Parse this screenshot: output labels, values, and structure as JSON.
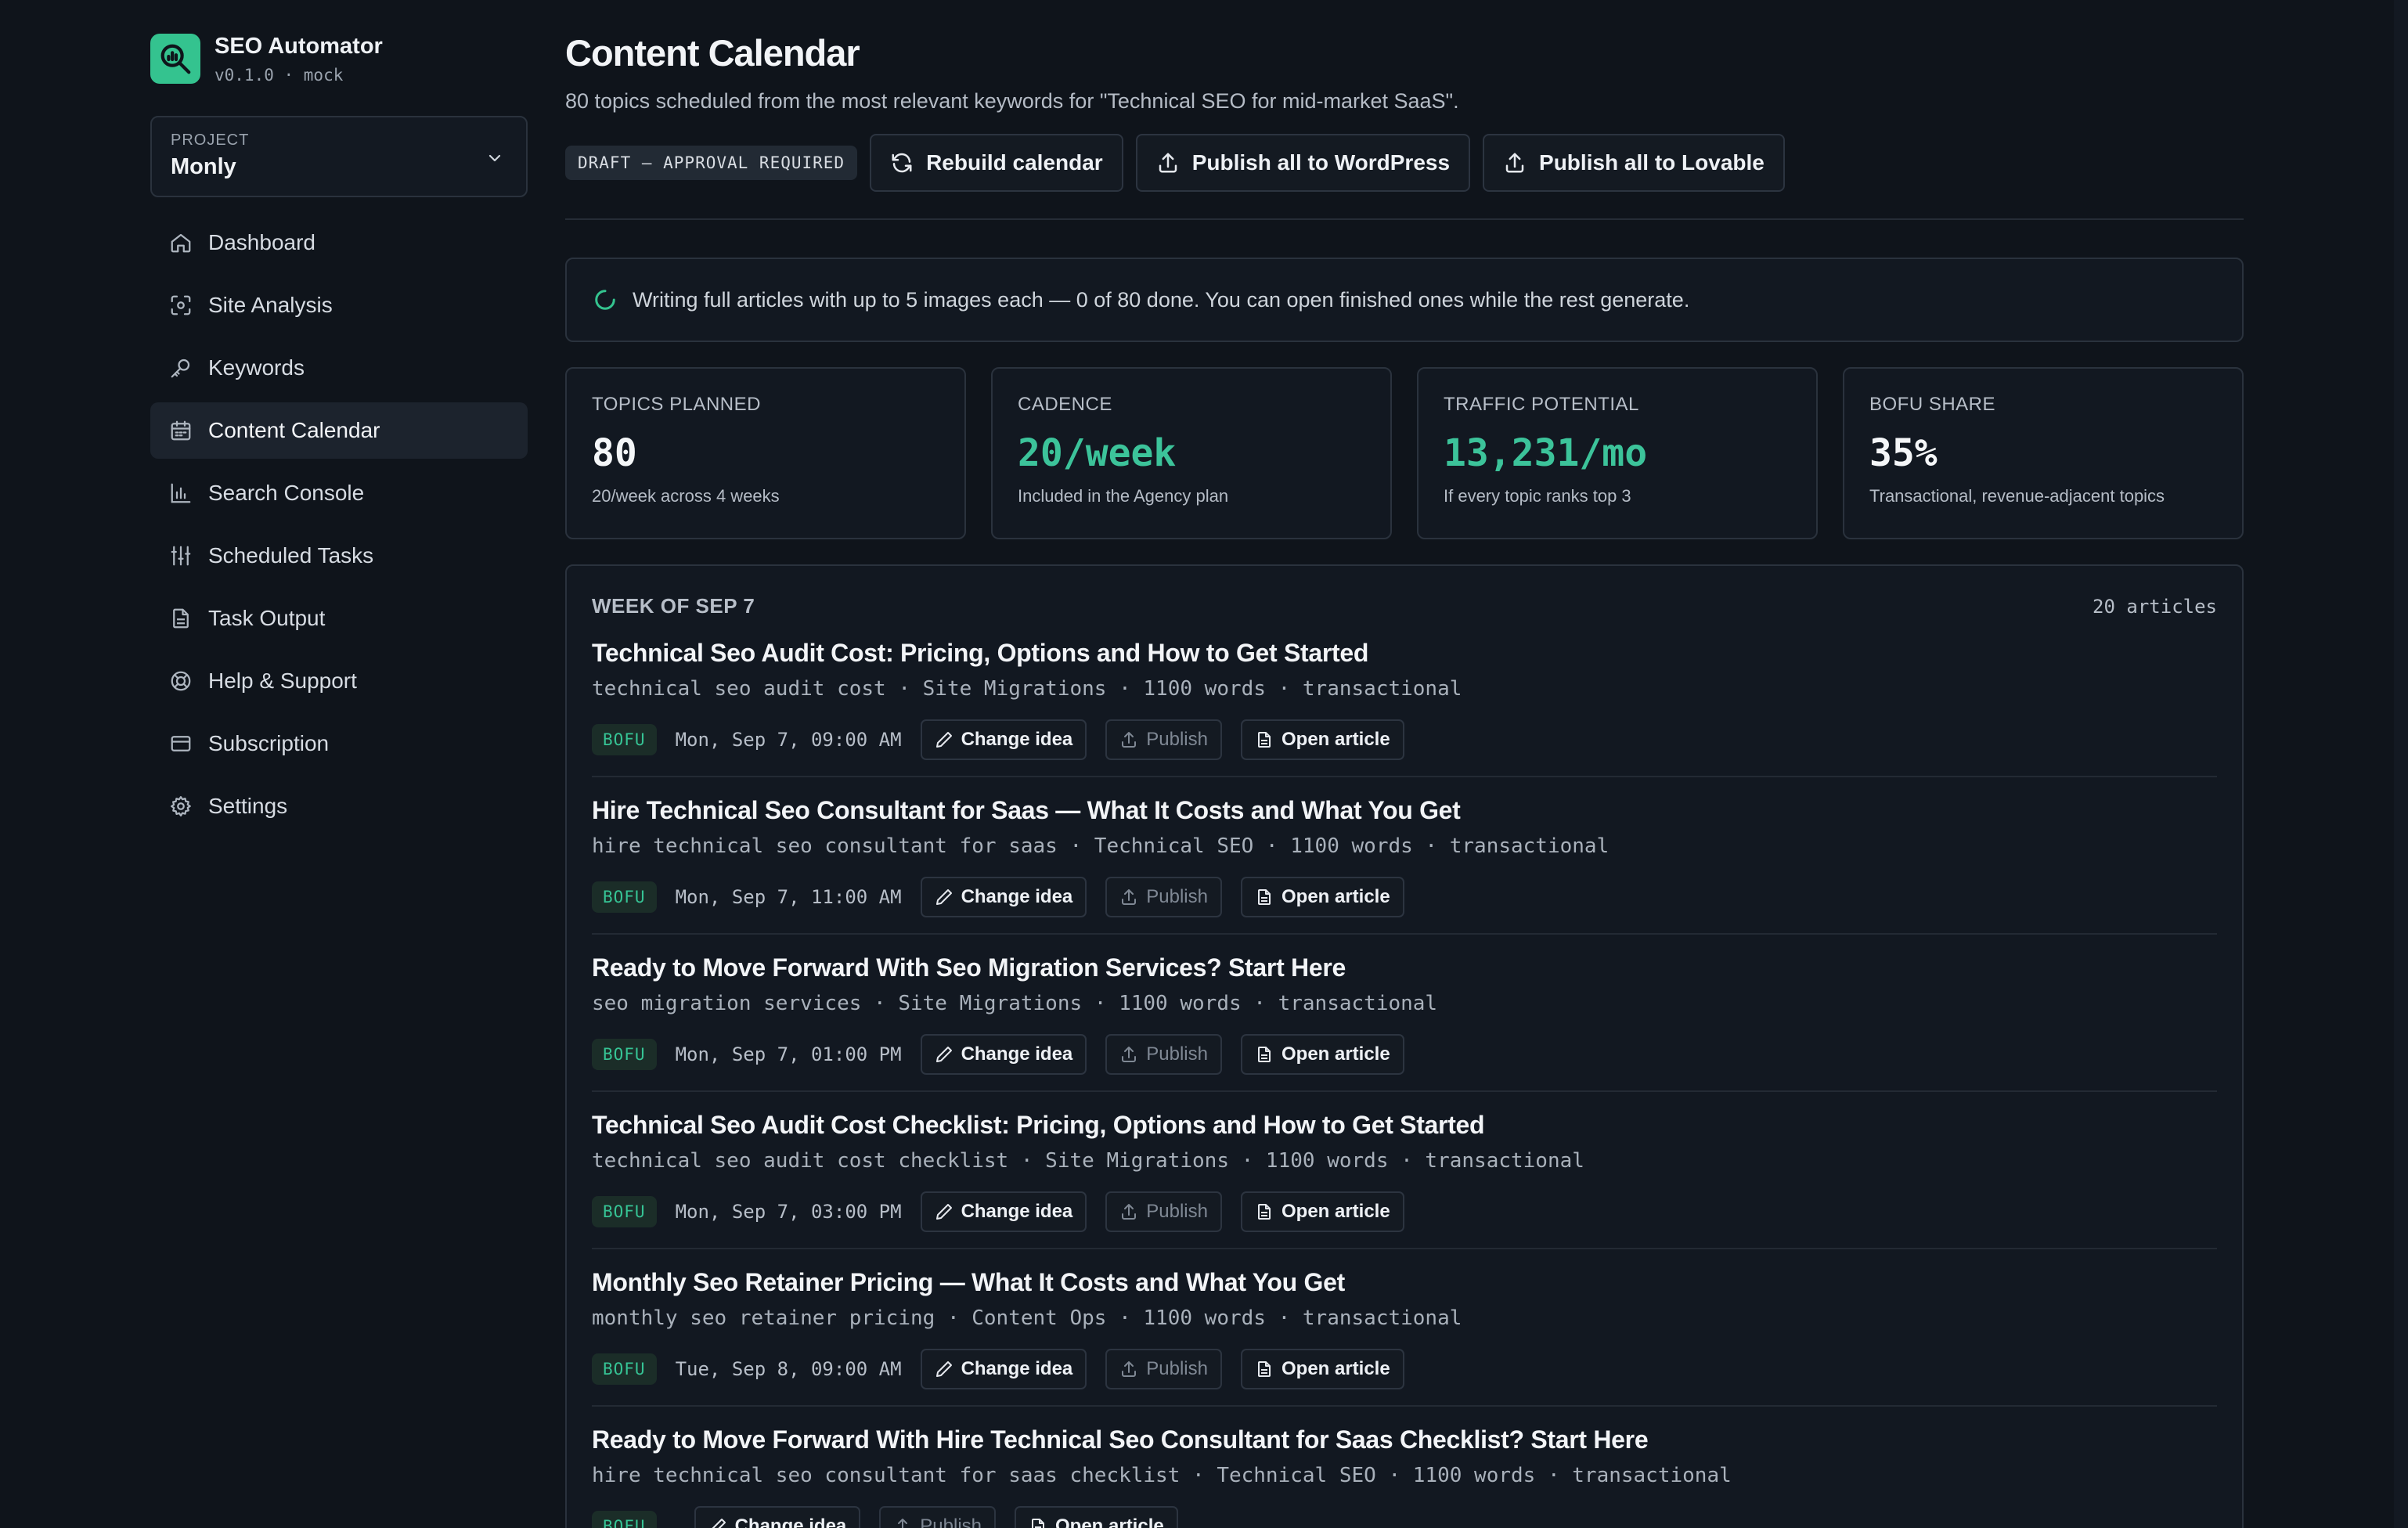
{
  "brand": {
    "name": "SEO Automator",
    "version": "v0.1.0 · mock"
  },
  "project": {
    "label": "PROJECT",
    "value": "Monly"
  },
  "nav": [
    {
      "label": "Dashboard",
      "icon": "home-icon",
      "active": false
    },
    {
      "label": "Site Analysis",
      "icon": "scan-icon",
      "active": false
    },
    {
      "label": "Keywords",
      "icon": "key-icon",
      "active": false
    },
    {
      "label": "Content Calendar",
      "icon": "calendar-icon",
      "active": true
    },
    {
      "label": "Search Console",
      "icon": "bar-chart-icon",
      "active": false
    },
    {
      "label": "Scheduled Tasks",
      "icon": "sliders-icon",
      "active": false
    },
    {
      "label": "Task Output",
      "icon": "file-icon",
      "active": false
    },
    {
      "label": "Help & Support",
      "icon": "lifebuoy-icon",
      "active": false
    },
    {
      "label": "Subscription",
      "icon": "credit-card-icon",
      "active": false
    },
    {
      "label": "Settings",
      "icon": "gear-icon",
      "active": false
    }
  ],
  "page": {
    "title": "Content Calendar",
    "subtitle": "80 topics scheduled from the most relevant keywords for \"Technical SEO for mid-market SaaS\"."
  },
  "toolbar": {
    "draft_badge": "DRAFT — APPROVAL REQUIRED",
    "rebuild": "Rebuild calendar",
    "publish_wp": "Publish all to WordPress",
    "publish_lovable": "Publish all to Lovable"
  },
  "progress": {
    "text": "Writing full articles with up to 5 images each — 0 of 80 done. You can open finished ones while the rest generate."
  },
  "stats": [
    {
      "label": "TOPICS PLANNED",
      "value": "80",
      "sub": "20/week across 4 weeks",
      "accent": false
    },
    {
      "label": "CADENCE",
      "value": "20/week",
      "sub": "Included in the Agency plan",
      "accent": true
    },
    {
      "label": "TRAFFIC POTENTIAL",
      "value": "13,231/mo",
      "sub": "If every topic ranks top 3",
      "accent": true
    },
    {
      "label": "BOFU SHARE",
      "value": "35%",
      "sub": "Transactional, revenue-adjacent topics",
      "accent": false
    }
  ],
  "week": {
    "title": "WEEK OF SEP 7",
    "count": "20 articles",
    "buttons": {
      "change": "Change idea",
      "publish": "Publish",
      "open": "Open article"
    },
    "articles": [
      {
        "title": "Technical Seo Audit Cost: Pricing, Options and How to Get Started",
        "meta": "technical seo audit cost · Site Migrations · 1100 words · transactional",
        "stage": "BOFU",
        "date": "Mon, Sep 7, 09:00 AM"
      },
      {
        "title": "Hire Technical Seo Consultant for Saas — What It Costs and What You Get",
        "meta": "hire technical seo consultant for saas · Technical SEO · 1100 words · transactional",
        "stage": "BOFU",
        "date": "Mon, Sep 7, 11:00 AM"
      },
      {
        "title": "Ready to Move Forward With Seo Migration Services? Start Here",
        "meta": "seo migration services · Site Migrations · 1100 words · transactional",
        "stage": "BOFU",
        "date": "Mon, Sep 7, 01:00 PM"
      },
      {
        "title": "Technical Seo Audit Cost Checklist: Pricing, Options and How to Get Started",
        "meta": "technical seo audit cost checklist · Site Migrations · 1100 words · transactional",
        "stage": "BOFU",
        "date": "Mon, Sep 7, 03:00 PM"
      },
      {
        "title": "Monthly Seo Retainer Pricing — What It Costs and What You Get",
        "meta": "monthly seo retainer pricing · Content Ops · 1100 words · transactional",
        "stage": "BOFU",
        "date": "Tue, Sep 8, 09:00 AM"
      },
      {
        "title": "Ready to Move Forward With Hire Technical Seo Consultant for Saas Checklist? Start Here",
        "meta": "hire technical seo consultant for saas checklist · Technical SEO · 1100 words · transactional",
        "stage": "BOFU",
        "date": ""
      }
    ]
  },
  "colors": {
    "accent": "#34c38f",
    "background": "#0f141b",
    "card": "#121821"
  }
}
